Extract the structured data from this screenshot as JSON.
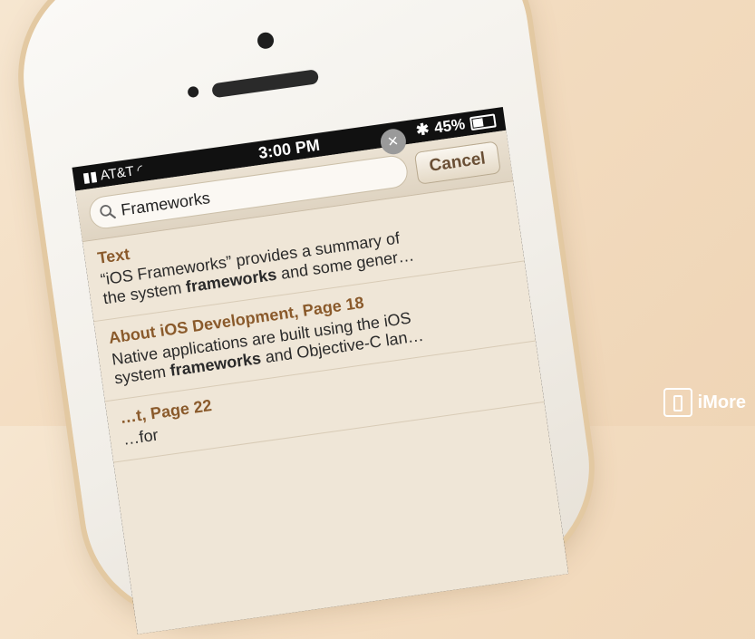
{
  "status": {
    "carrier": "AT&T",
    "time": "3:00 PM",
    "battery": "45%"
  },
  "search": {
    "query": "Frameworks",
    "cancel_label": "Cancel"
  },
  "results": [
    {
      "title": "Text",
      "line1": "“iOS Frameworks” provides a summary of",
      "line2_pre": "the system ",
      "line2_bold": "frameworks",
      "line2_post": " and some gener…"
    },
    {
      "title": "About iOS Development, Page 18",
      "line1": "Native applications are built using the iOS",
      "line2_pre": "system ",
      "line2_bold": "frameworks",
      "line2_post": " and Objective-C lan…"
    },
    {
      "title": "…t, Page 22",
      "line1": "…for",
      "line2_pre": "",
      "line2_bold": "",
      "line2_post": ""
    }
  ],
  "watermark": {
    "brand": "iMore"
  },
  "icons": {
    "search": "search-icon",
    "clear": "clear-icon",
    "wifi": "wifi-icon",
    "bluetooth": "bluetooth-icon",
    "battery": "battery-icon"
  }
}
